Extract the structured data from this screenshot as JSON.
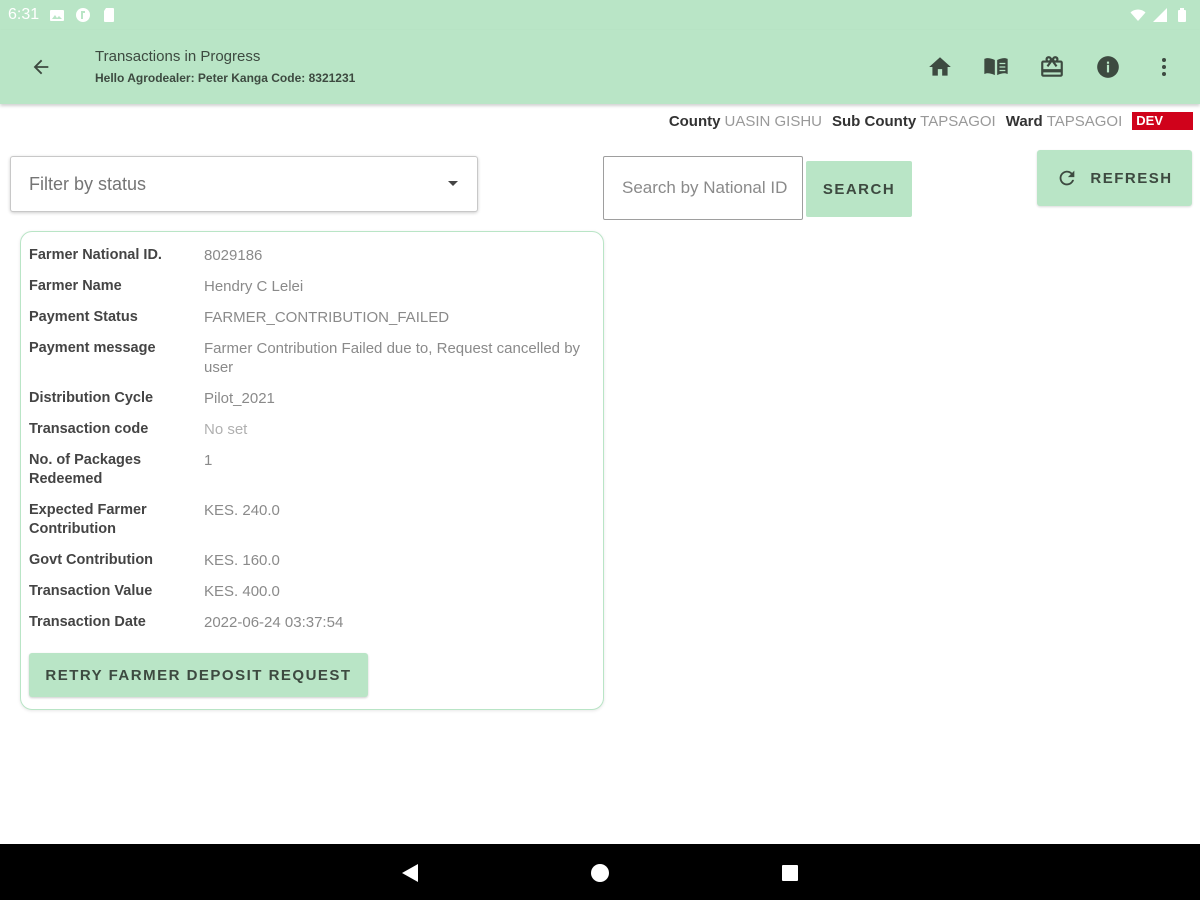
{
  "status_bar": {
    "time": "6:31",
    "icons_left": [
      "image-icon",
      "app-icon",
      "sd-card-icon"
    ],
    "icons_right": [
      "wifi-icon",
      "signal-icon",
      "battery-icon"
    ]
  },
  "app_bar": {
    "title": "Transactions in Progress",
    "subtitle": "Hello Agrodealer: Peter Kanga Code: 8321231",
    "back_icon": "arrow-back-icon",
    "action_icons": [
      "home-icon",
      "book-icon",
      "gift-card-icon",
      "info-icon",
      "more-vert-icon"
    ]
  },
  "location": {
    "county_label": "County",
    "county_value": "UASIN GISHU",
    "subcounty_label": "Sub County",
    "subcounty_value": "TAPSAGOI",
    "ward_label": "Ward",
    "ward_value": "TAPSAGOI",
    "env_badge": "DEV",
    "env_badge_color": "#d0021b"
  },
  "filter": {
    "placeholder": "Filter by status"
  },
  "search": {
    "placeholder": "Search by National ID",
    "button_label": "SEARCH"
  },
  "refresh": {
    "label": "REFRESH"
  },
  "transaction": {
    "fields": [
      {
        "label": "Farmer National ID.",
        "value": "8029186"
      },
      {
        "label": "Farmer Name",
        "value": "Hendry C Lelei"
      },
      {
        "label": "Payment Status",
        "value": "FARMER_CONTRIBUTION_FAILED"
      },
      {
        "label": "Payment message",
        "value": "Farmer Contribution Failed due to, Request cancelled by user"
      },
      {
        "label": "Distribution Cycle",
        "value": "Pilot_2021"
      },
      {
        "label": "Transaction code",
        "value": "No set"
      },
      {
        "label": "No. of Packages Redeemed",
        "value": "1"
      },
      {
        "label": "Expected Farmer Contribution",
        "value": "KES. 240.0"
      },
      {
        "label": "Govt Contribution",
        "value": "KES. 160.0"
      },
      {
        "label": "Transaction Value",
        "value": "KES. 400.0"
      },
      {
        "label": "Transaction Date",
        "value": "2022-06-24 03:37:54"
      }
    ],
    "retry_button": "RETRY FARMER DEPOSIT REQUEST"
  },
  "theme": {
    "primary": "#b9e5c6",
    "on_primary": "#3d4a40"
  }
}
